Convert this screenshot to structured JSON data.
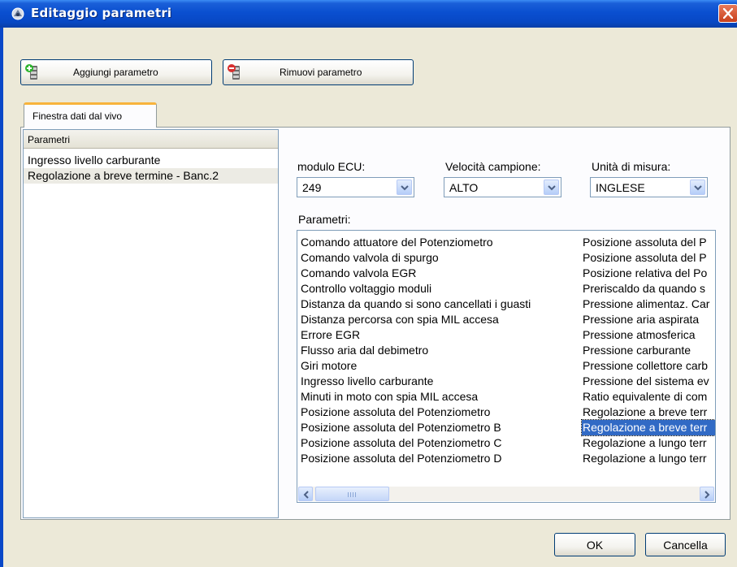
{
  "window": {
    "title": "Editaggio parametri"
  },
  "toolbar": {
    "add_label": "Aggiungi parametro",
    "remove_label": "Rimuovi parametro"
  },
  "tabs": [
    {
      "label": "Finestra dati dal vivo"
    }
  ],
  "left_list": {
    "header": "Parametri",
    "items": [
      "Ingresso livello carburante",
      "Regolazione a breve termine - Banc.2"
    ]
  },
  "filters": {
    "ecu_label": "modulo ECU:",
    "ecu_value": "249",
    "speed_label": "Velocità campione:",
    "speed_value": "ALTO",
    "units_label": "Unità di misura:",
    "units_value": "INGLESE"
  },
  "params": {
    "label": "Parametri:",
    "col1": [
      "Comando attuatore del Potenziometro",
      "Comando valvola di spurgo",
      "Comando valvola EGR",
      "Controllo voltaggio moduli",
      "Distanza da quando si sono cancellati i guasti",
      "Distanza percorsa con spia MIL accesa",
      "Errore EGR",
      "Flusso aria dal debimetro",
      "Giri motore",
      "Ingresso livello carburante",
      "Minuti in moto con spia MIL accesa",
      "Posizione assoluta del Potenziometro",
      "Posizione assoluta del Potenziometro B",
      "Posizione assoluta del Potenziometro C",
      "Posizione assoluta del Potenziometro D"
    ],
    "col2": [
      "Posizione assoluta del P",
      "Posizione assoluta del P",
      "Posizione relativa del Po",
      "Preriscaldo da quando s",
      "Pressione alimentaz. Car",
      "Pressione aria aspirata",
      "Pressione atmosferica",
      "Pressione carburante",
      "Pressione collettore carb",
      "Pressione del sistema ev",
      "Ratio equivalente di com",
      "Regolazione a breve terr",
      "Regolazione a breve terr",
      "Regolazione a lungo terr",
      "Regolazione a lungo terr"
    ]
  },
  "buttons": {
    "ok": "OK",
    "cancel": "Cancella"
  },
  "colors": {
    "titlebar": "#0a4fd0",
    "selection": "#316ac5",
    "tab_accent": "#f8b33c"
  }
}
